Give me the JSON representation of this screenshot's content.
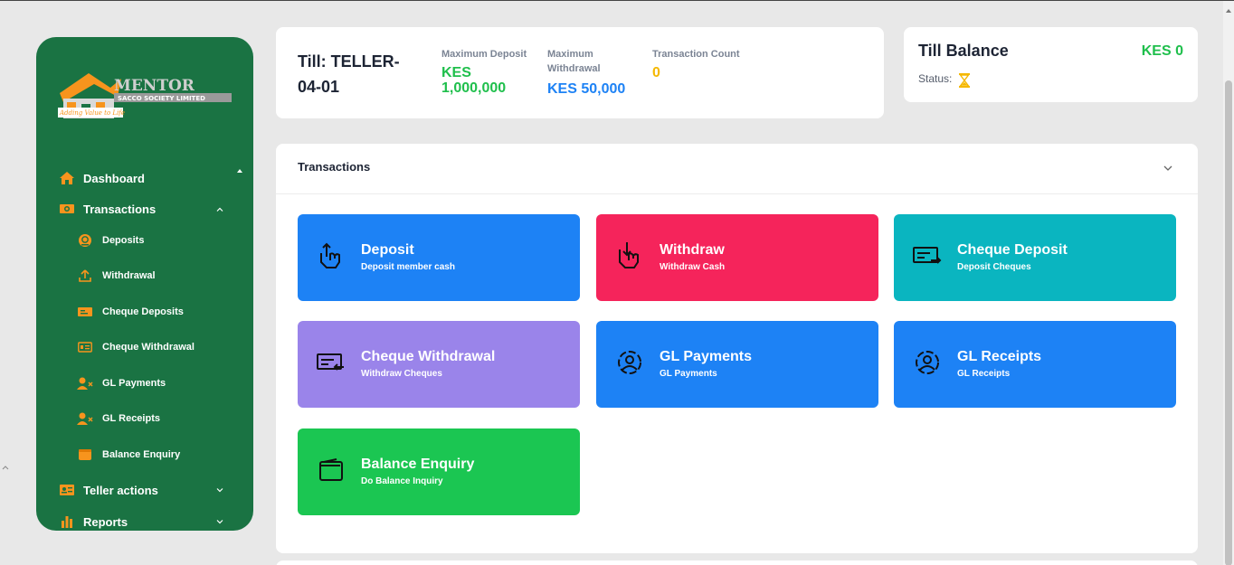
{
  "sidebar": {
    "logo": {
      "brand": "MENTOR",
      "sub": "SACCO SOCIETY LIMITED",
      "tagline": "Adding Value to Life"
    },
    "items": [
      {
        "label": "Dashboard",
        "icon": "home-icon"
      },
      {
        "label": "Transactions",
        "icon": "cash-icon"
      },
      {
        "label": "Teller actions",
        "icon": "id-card-icon"
      },
      {
        "label": "Reports",
        "icon": "bar-chart-icon"
      }
    ],
    "sub_items": [
      {
        "label": "Deposits",
        "icon": "coin-icon"
      },
      {
        "label": "Withdrawal",
        "icon": "upload-icon"
      },
      {
        "label": "Cheque Deposits",
        "icon": "cheque-icon"
      },
      {
        "label": "Cheque Withdrawal",
        "icon": "cheque-dollar-icon"
      },
      {
        "label": "GL Payments",
        "icon": "user-x-icon"
      },
      {
        "label": "GL Receipts",
        "icon": "user-x-icon"
      },
      {
        "label": "Balance Enquiry",
        "icon": "wallet-icon"
      }
    ]
  },
  "till": {
    "name": "Till: TELLER-04-01",
    "max_deposit_label": "Maximum Deposit",
    "max_deposit_value": "KES 1,000,000",
    "max_withdrawal_label": "Maximum Withdrawal",
    "max_withdrawal_value": "KES 50,000",
    "txn_count_label": "Transaction Count",
    "txn_count_value": "0"
  },
  "balance": {
    "title": "Till Balance",
    "value": "KES 0",
    "status_label": "Status:",
    "status_icon": "hourglass-icon"
  },
  "transactions": {
    "title": "Transactions",
    "tiles": [
      {
        "title": "Deposit",
        "subtitle": "Deposit member cash",
        "color": "#1d82f5",
        "icon": "hand-up-icon"
      },
      {
        "title": "Withdraw",
        "subtitle": "Withdraw Cash",
        "color": "#f5245b",
        "icon": "hand-down-icon"
      },
      {
        "title": "Cheque Deposit",
        "subtitle": "Deposit Cheques",
        "color": "#0ab5c0",
        "icon": "cheque-in-icon"
      },
      {
        "title": "Cheque Withdrawal",
        "subtitle": "Withdraw Cheques",
        "color": "#9a84ea",
        "icon": "cheque-out-icon"
      },
      {
        "title": "GL Payments",
        "subtitle": "GL Payments",
        "color": "#1d82f5",
        "icon": "user-circle-icon"
      },
      {
        "title": "GL Receipts",
        "subtitle": "GL Receipts",
        "color": "#1d82f5",
        "icon": "user-circle-icon"
      },
      {
        "title": "Balance Enquiry",
        "subtitle": "Do Balance Inquiry",
        "color": "#1bc652",
        "icon": "wallet-icon"
      }
    ]
  },
  "colors": {
    "sidebar_bg": "#1a7343",
    "accent_orange": "#f7941d",
    "deposit_green": "#1fbf4c",
    "withdraw_blue": "#1d82f5",
    "count_yellow": "#f5b800"
  }
}
